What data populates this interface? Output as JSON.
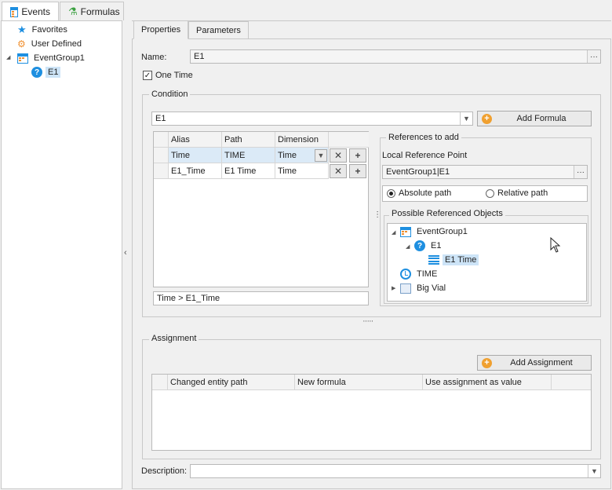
{
  "top_tabs": [
    {
      "label": "Events",
      "active": true
    },
    {
      "label": "Formulas",
      "active": false
    }
  ],
  "tree": {
    "items": [
      {
        "label": "Favorites",
        "icon": "star-icon"
      },
      {
        "label": "User Defined",
        "icon": "user-defined-icon"
      },
      {
        "label": "EventGroup1",
        "icon": "event-group-icon"
      },
      {
        "label": "E1",
        "icon": "question-icon"
      }
    ]
  },
  "inner_tabs": [
    {
      "label": "Properties",
      "active": true
    },
    {
      "label": "Parameters",
      "active": false
    }
  ],
  "properties": {
    "name_label": "Name:",
    "name_value": "E1",
    "one_time_label": "One Time",
    "one_time_checked": true,
    "condition": {
      "title": "Condition",
      "formula_value": "E1",
      "add_formula_label": "Add Formula",
      "columns": [
        "Alias",
        "Path",
        "Dimension"
      ],
      "rows": [
        {
          "alias": "Time",
          "path": "TIME",
          "dimension": "Time"
        },
        {
          "alias": "E1_Time",
          "path": "E1 Time",
          "dimension": "Time"
        }
      ],
      "expression": "Time > E1_Time",
      "references": {
        "title": "References to add",
        "local_ref_label": "Local Reference Point",
        "local_ref_value": "EventGroup1|E1",
        "absolute_label": "Absolute path",
        "relative_label": "Relative path",
        "possible_title": "Possible Referenced Objects",
        "tree": [
          {
            "label": "EventGroup1"
          },
          {
            "label": "E1"
          },
          {
            "label": "E1 Time"
          },
          {
            "label": "TIME"
          },
          {
            "label": "Big Vial"
          }
        ]
      }
    },
    "assignment": {
      "title": "Assignment",
      "add_assignment_label": "Add Assignment",
      "columns": [
        "Changed entity path",
        "New formula",
        "Use assignment as value"
      ]
    },
    "description_label": "Description:",
    "description_value": ""
  },
  "colors": {
    "accent": "#1e8fe0",
    "selection": "#cde4f7",
    "add_icon": "#f0a030"
  }
}
